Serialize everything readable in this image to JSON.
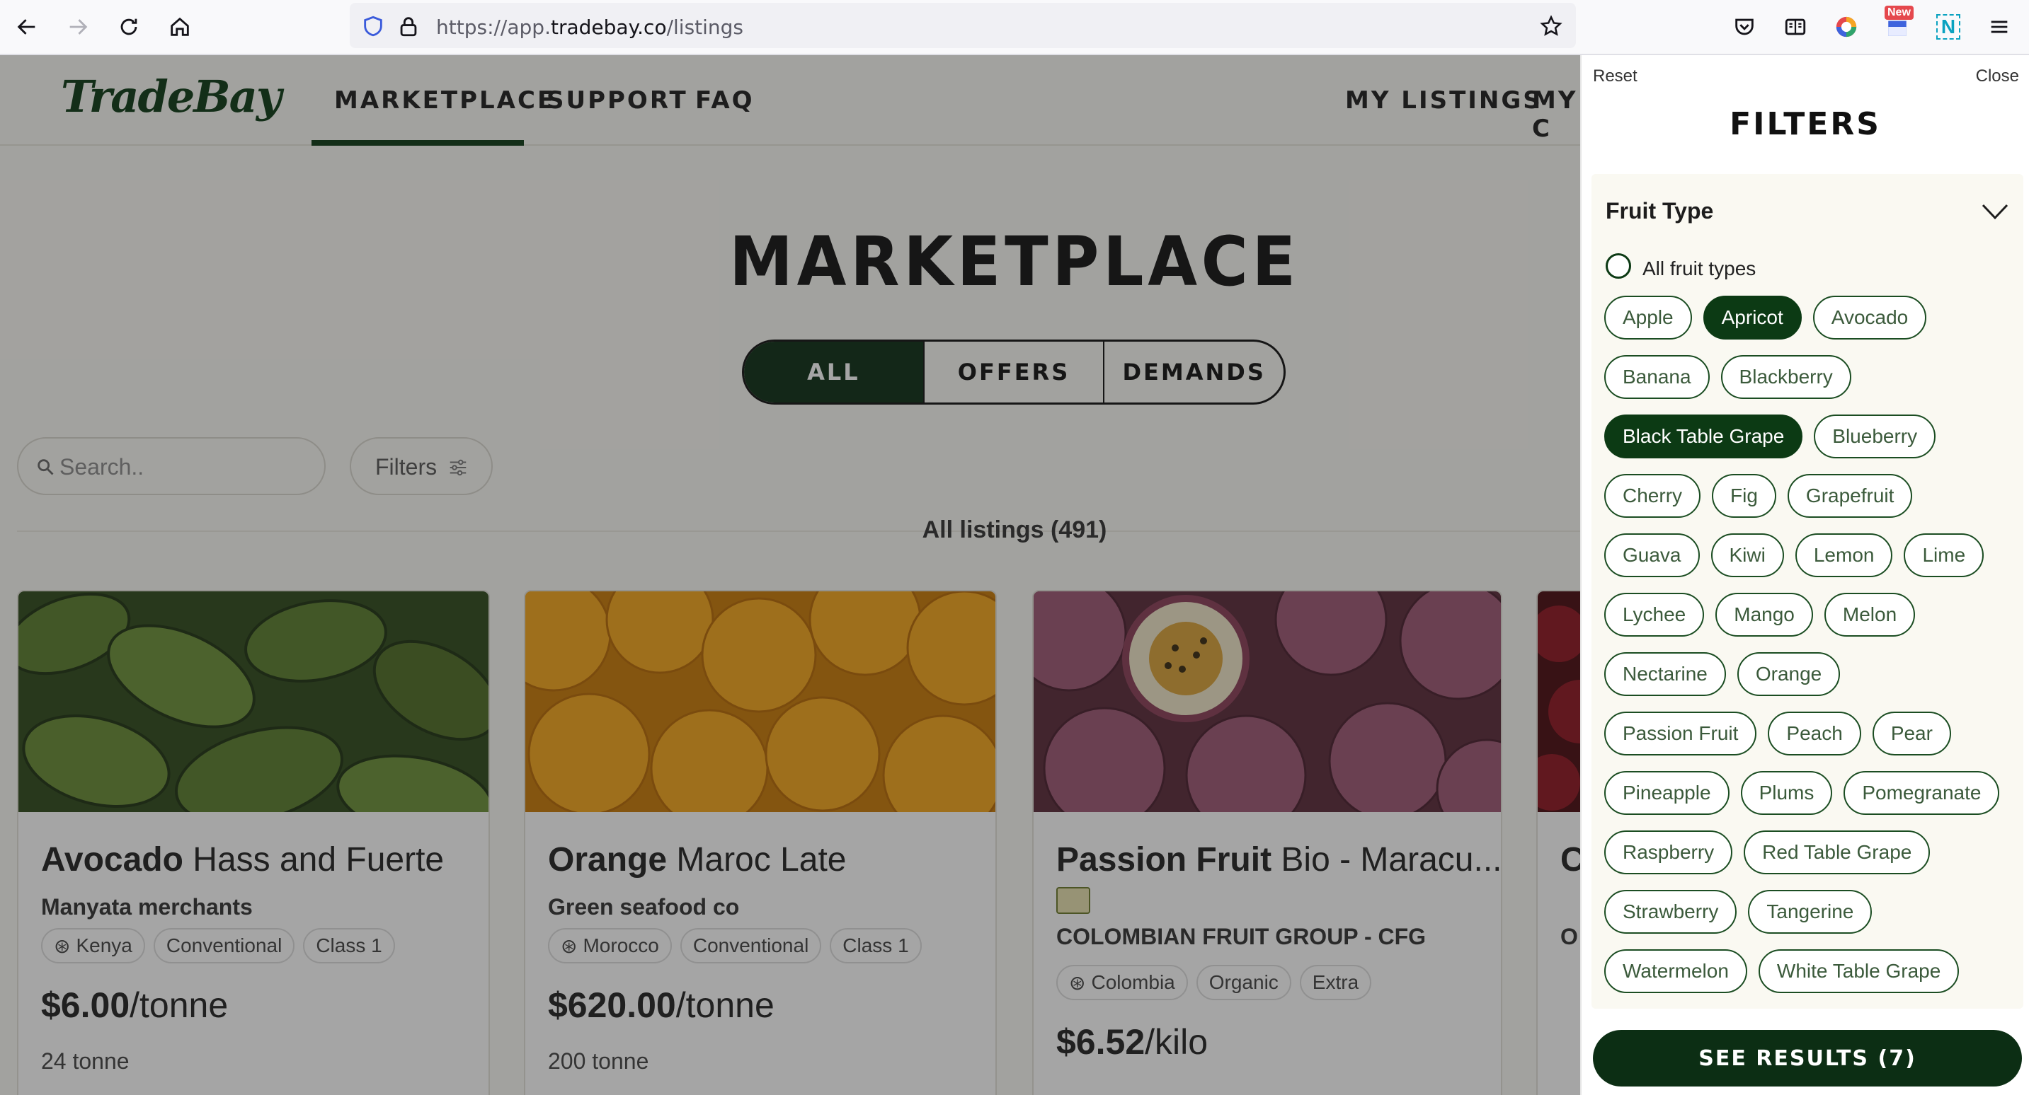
{
  "browser": {
    "url_prefix": "https://app.",
    "url_domain": "tradebay.co",
    "url_path": "/listings",
    "badge_new": "New",
    "ext_n": "N"
  },
  "site": {
    "logo": "TradeBay",
    "nav": [
      "MARKETPLACE",
      "SUPPORT",
      "FAQ"
    ],
    "nav_right": [
      "MY LISTINGS",
      "MY C"
    ],
    "accent_color": "#0c3a14"
  },
  "marketplace": {
    "title": "MARKETPLACE",
    "segments": [
      "ALL",
      "OFFERS",
      "DEMANDS"
    ],
    "active_segment": "ALL",
    "search_placeholder": "Search..",
    "filters_label": "Filters",
    "listing_count": "All listings (491)"
  },
  "cards": [
    {
      "title_bold": "Avocado",
      "title_rest": " Hass and Fuerte",
      "seller": "Manyata merchants",
      "tags": [
        "Kenya",
        "Conventional",
        "Class 1"
      ],
      "price_bold": "$6.00",
      "price_unit": "/tonne",
      "quantity": "24 tonne"
    },
    {
      "title_bold": "Orange",
      "title_rest": " Maroc Late",
      "seller": "Green seafood co",
      "tags": [
        "Morocco",
        "Conventional",
        "Class 1"
      ],
      "price_bold": "$620.00",
      "price_unit": "/tonne",
      "quantity": "200 tonne"
    },
    {
      "title_bold": "Passion Fruit",
      "title_rest": " Bio - Maracu...",
      "seller": "COLOMBIAN FRUIT GROUP - CFG",
      "tags": [
        "Colombia",
        "Organic",
        "Extra"
      ],
      "price_bold": "$6.52",
      "price_unit": "/kilo",
      "quantity": ""
    },
    {
      "title_bold": "C",
      "title_rest": "",
      "seller": "O",
      "tags": [],
      "price_bold": "",
      "price_unit": "",
      "quantity": ""
    }
  ],
  "drawer": {
    "reset": "Reset",
    "close": "Close",
    "title": "FILTERS",
    "section_title": "Fruit Type",
    "all_option": "All fruit types",
    "chip_rows": [
      [
        "Apple",
        "Apricot",
        "Avocado"
      ],
      [
        "Banana",
        "Blackberry"
      ],
      [
        "Black Table Grape",
        "Blueberry"
      ],
      [
        "Cherry",
        "Fig",
        "Grapefruit"
      ],
      [
        "Guava",
        "Kiwi",
        "Lemon",
        "Lime"
      ],
      [
        "Lychee",
        "Mango",
        "Melon"
      ],
      [
        "Nectarine",
        "Orange"
      ],
      [
        "Passion Fruit",
        "Peach",
        "Pear"
      ],
      [
        "Pineapple",
        "Plums",
        "Pomegranate"
      ],
      [
        "Raspberry",
        "Red Table Grape"
      ],
      [
        "Strawberry",
        "Tangerine"
      ],
      [
        "Watermelon",
        "White Table Grape"
      ]
    ],
    "selected": [
      "Apricot",
      "Black Table Grape"
    ],
    "see_results": "SEE RESULTS (7)"
  }
}
